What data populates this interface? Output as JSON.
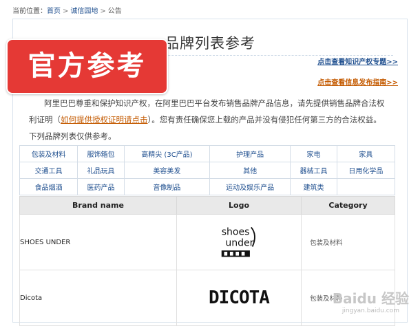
{
  "breadcrumb": {
    "prefix": "当前位置：",
    "home": "首页",
    "section": "诚信园地",
    "current": "公告",
    "sep": ">"
  },
  "page": {
    "title": "品牌列表参考",
    "badge": "官方参考",
    "link_ip": "点击查看知识产权专题>>",
    "link_guide": "点击查看信息发布指南>>",
    "intro_part1": "阿里巴巴尊重和保护知识产权，在阿里巴巴平台发布销售品牌产品信息，请先提供销售品牌合法权利证明（",
    "intro_link": "如何提供授权证明请点击",
    "intro_part2": "）。您有责任确保您上载的产品并没有侵犯任何第三方的合法权益。下列品牌列表仅供参考。"
  },
  "categories": [
    [
      "包装及材料",
      "服饰箱包",
      "高精尖 (3C产品)",
      "护理产品",
      "家电",
      "家具"
    ],
    [
      "交通工具",
      "礼品玩具",
      "美容美发",
      "其他",
      "器械工具",
      "日用化学品"
    ],
    [
      "食品烟酒",
      "医药产品",
      "音像制品",
      "运动及娱乐产品",
      "建筑类",
      ""
    ]
  ],
  "brand_table": {
    "headers": [
      "Brand name",
      "Logo",
      "Category"
    ],
    "rows": [
      {
        "name": "SHOES UNDER",
        "logo_text_1": "shoes",
        "logo_text_2": "under",
        "category": "包装及材料"
      },
      {
        "name": "Dicota",
        "logo_text": "DICOTA",
        "category": "包装及材料"
      }
    ]
  },
  "watermark": {
    "brand": "Baidu 经验",
    "url": "jingyan.baidu.com"
  },
  "colors": {
    "badge": "#e53935",
    "link_blue": "#1f4f8f",
    "link_orange": "#c45a00"
  }
}
